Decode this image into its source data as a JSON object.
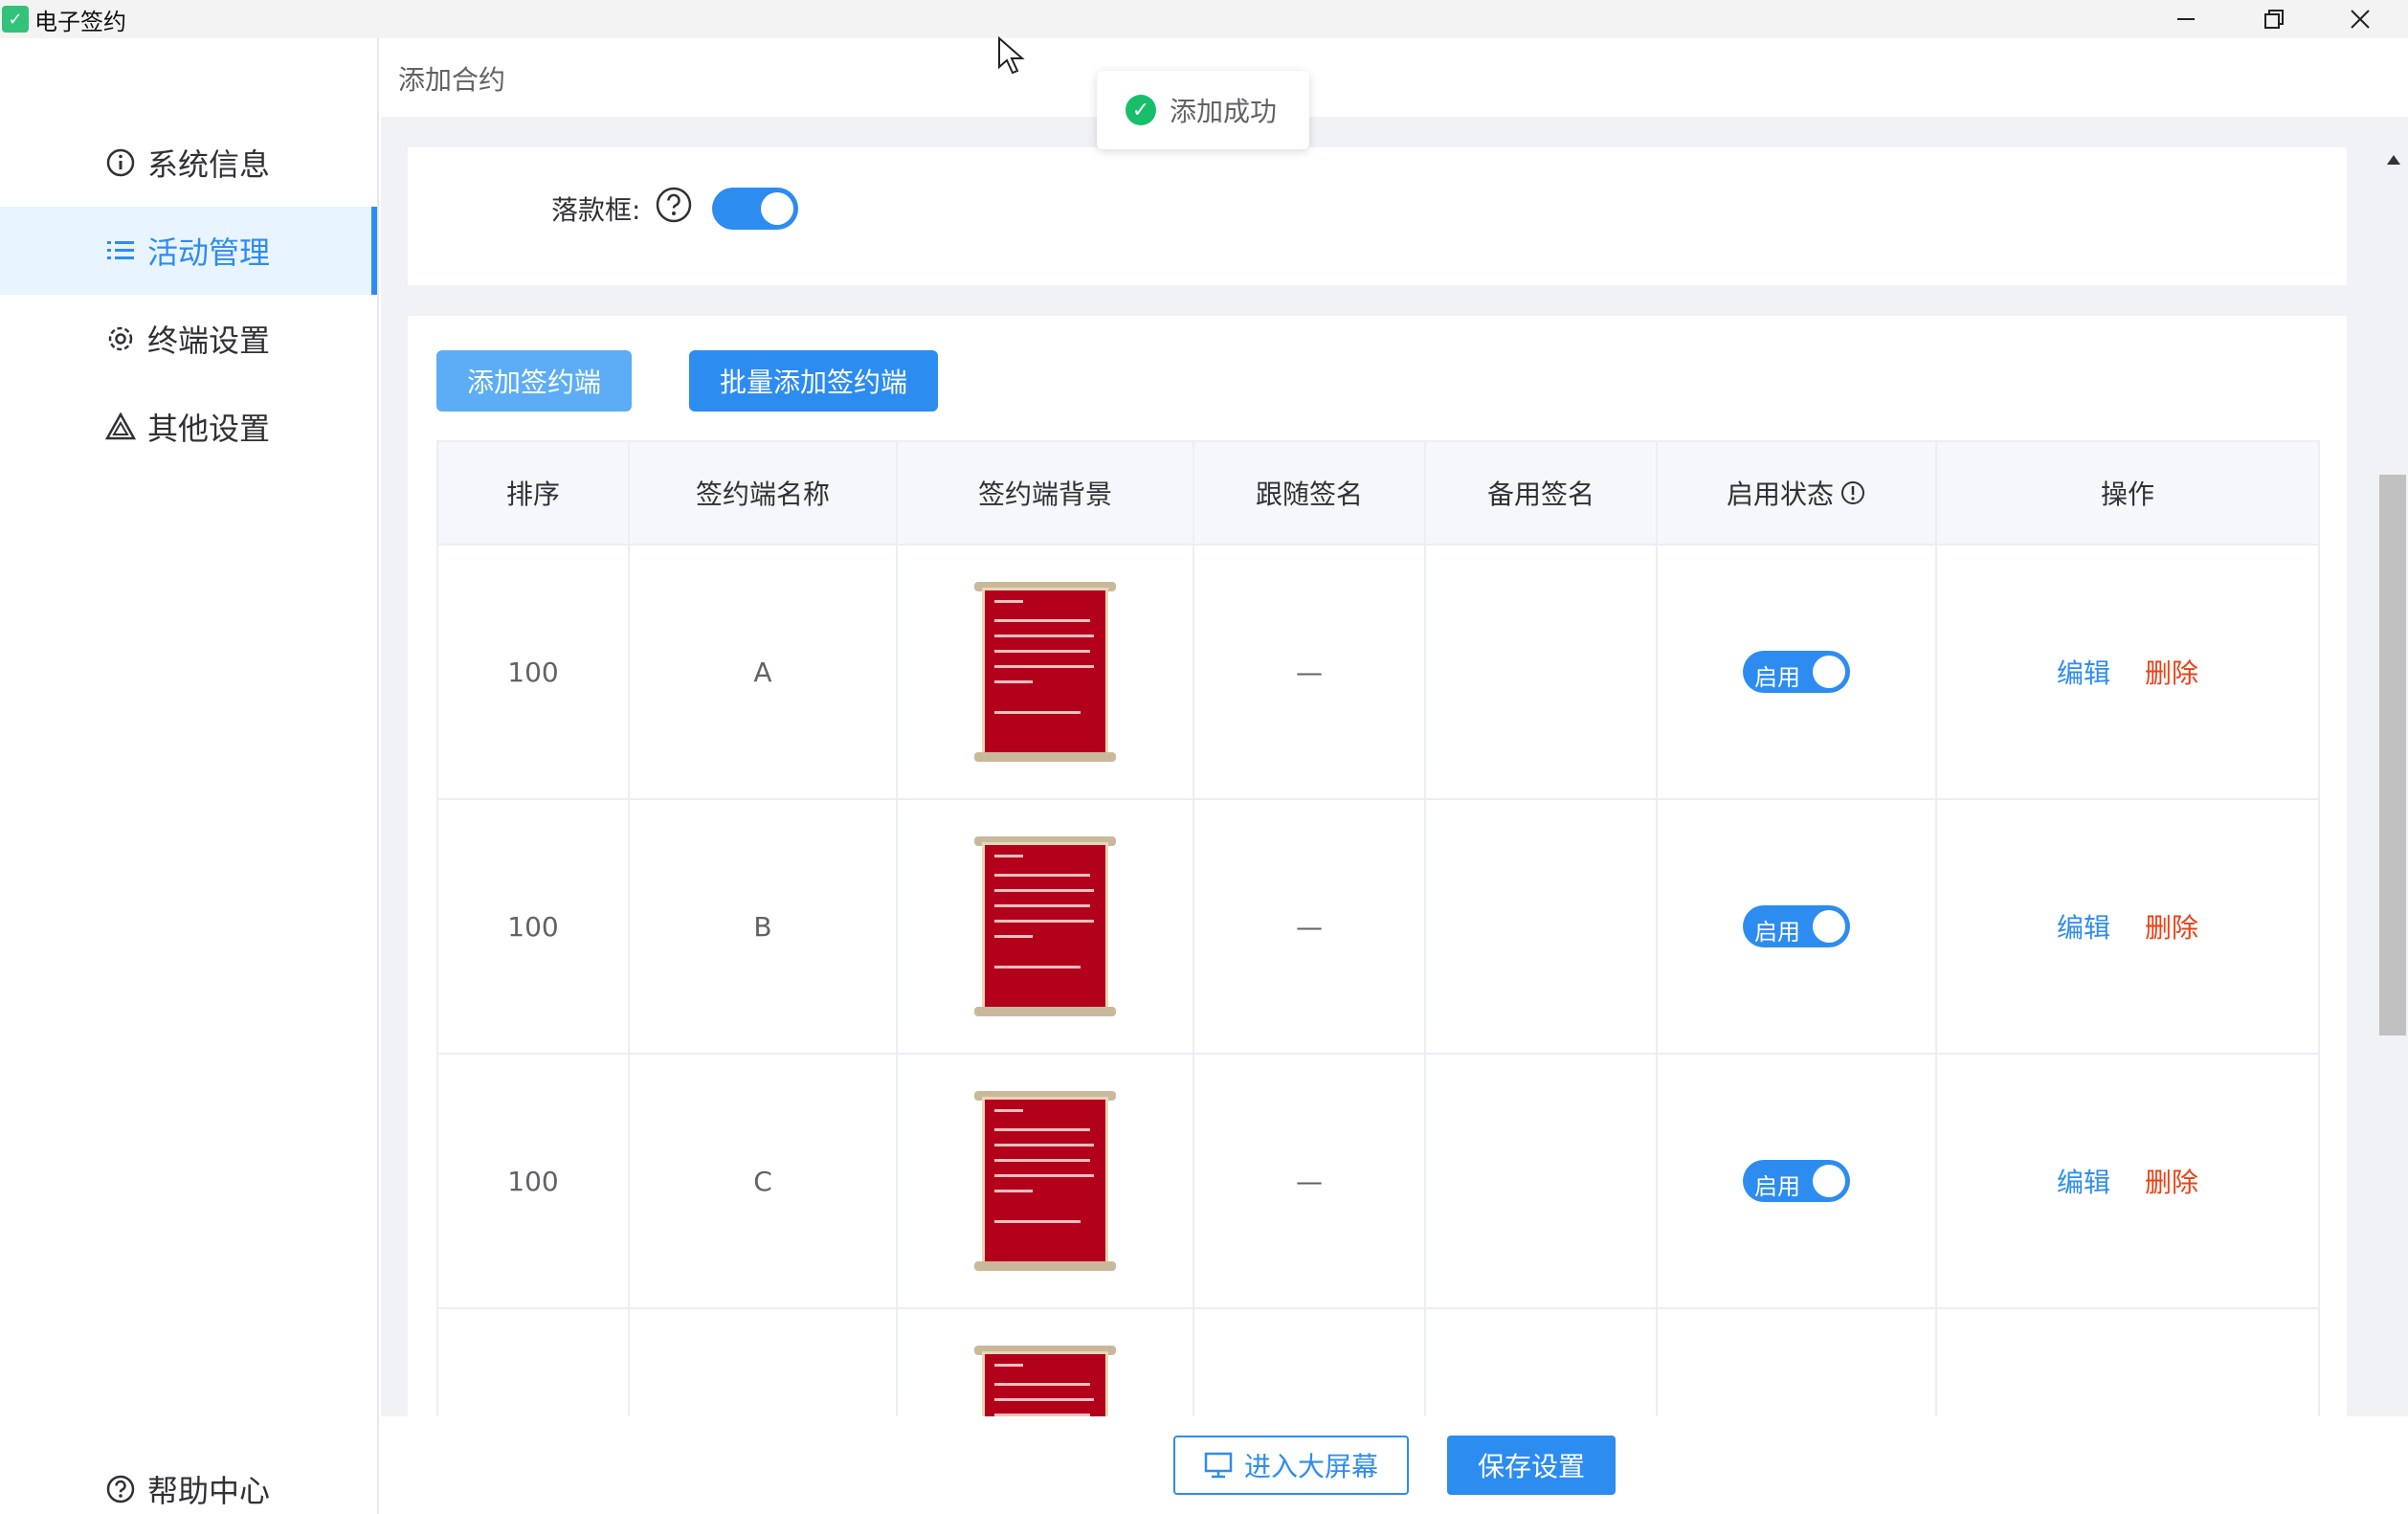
{
  "window": {
    "title": "电子签约"
  },
  "sidebar": {
    "items": [
      {
        "label": "系统信息",
        "icon": "info-icon",
        "active": false
      },
      {
        "label": "活动管理",
        "icon": "list-icon",
        "active": true
      },
      {
        "label": "终端设置",
        "icon": "gear-icon",
        "active": false
      },
      {
        "label": "其他设置",
        "icon": "triangle-warning-icon",
        "active": false
      }
    ],
    "help": {
      "label": "帮助中心",
      "icon": "help-circle-icon"
    }
  },
  "header": {
    "title": "添加合约"
  },
  "sign_box": {
    "label": "落款框:",
    "enabled": true
  },
  "toolbar": {
    "add_label": "添加签约端",
    "batch_add_label": "批量添加签约端"
  },
  "table": {
    "headers": [
      "排序",
      "签约端名称",
      "签约端背景",
      "跟随签名",
      "备用签名",
      "启用状态",
      "操作"
    ],
    "rows": [
      {
        "order": "100",
        "name": "A",
        "follow": "—",
        "backup": "",
        "status": "启用",
        "edit": "编辑",
        "delete": "删除"
      },
      {
        "order": "100",
        "name": "B",
        "follow": "—",
        "backup": "",
        "status": "启用",
        "edit": "编辑",
        "delete": "删除"
      },
      {
        "order": "100",
        "name": "C",
        "follow": "—",
        "backup": "",
        "status": "启用",
        "edit": "编辑",
        "delete": "删除"
      },
      {
        "order": "",
        "name": "",
        "follow": "",
        "backup": "",
        "status": "",
        "edit": "",
        "delete": ""
      }
    ]
  },
  "footer": {
    "enter_screen_label": "进入大屏幕",
    "save_label": "保存设置"
  },
  "toast": {
    "message": "添加成功"
  },
  "colors": {
    "primary": "#2d8cf0",
    "danger": "#ed4014",
    "success": "#19be6b",
    "active_bg": "#e8f4ff"
  }
}
